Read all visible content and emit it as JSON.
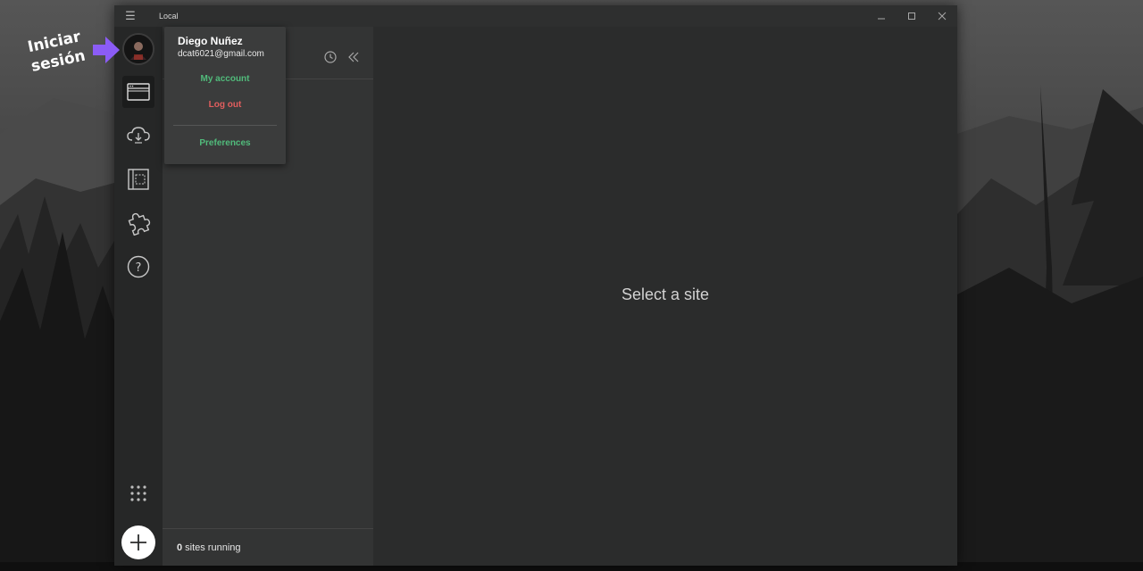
{
  "annotation": {
    "line1": "Iniciar",
    "line2": "sesión"
  },
  "window": {
    "title": "Local"
  },
  "dropdown": {
    "user_name": "Diego Nuñez",
    "user_email": "dcat6021@gmail.com",
    "my_account": "My account",
    "log_out": "Log out",
    "preferences": "Preferences"
  },
  "rail": {
    "icons": [
      "sites-icon",
      "cloud-icon",
      "blueprints-icon",
      "addons-icon",
      "help-icon",
      "apps-grid-icon",
      "add-site-icon"
    ]
  },
  "sites_panel": {
    "running_count": "0",
    "running_label": "sites running"
  },
  "main": {
    "empty_message": "Select a site"
  },
  "colors": {
    "accent_green": "#51bb7b",
    "logout_red": "#e25e5e",
    "arrow_purple": "#8b5cf6"
  }
}
